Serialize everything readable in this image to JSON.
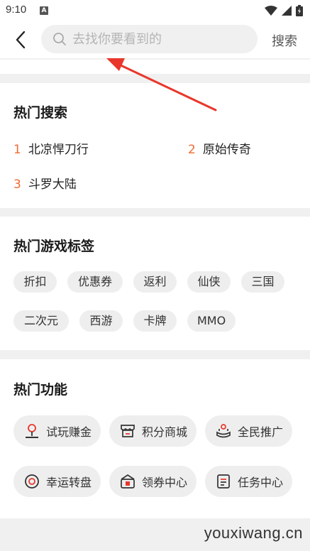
{
  "status": {
    "time": "9:10",
    "notif_letter": "A"
  },
  "header": {
    "search_placeholder": "去找你要看到的",
    "search_button": "搜索"
  },
  "hot_search": {
    "title": "热门搜索",
    "items": [
      {
        "num": "1",
        "label": "北凉悍刀行"
      },
      {
        "num": "2",
        "label": "原始传奇"
      },
      {
        "num": "3",
        "label": "斗罗大陆"
      }
    ]
  },
  "hot_tags": {
    "title": "热门游戏标签",
    "tags": [
      "折扣",
      "优惠券",
      "返利",
      "仙侠",
      "三国",
      "二次元",
      "西游",
      "卡牌",
      "MMO"
    ]
  },
  "hot_functions": {
    "title": "热门功能",
    "items": [
      {
        "label": "试玩赚金",
        "icon": "joystick-icon"
      },
      {
        "label": "积分商城",
        "icon": "store-icon"
      },
      {
        "label": "全民推广",
        "icon": "promote-icon"
      },
      {
        "label": "幸运转盘",
        "icon": "wheel-icon"
      },
      {
        "label": "领券中心",
        "icon": "coupon-icon"
      },
      {
        "label": "任务中心",
        "icon": "task-list-icon"
      }
    ]
  },
  "watermark": "youxiwang.cn",
  "colors": {
    "accent": "#ef6a35",
    "annotation_arrow": "#e8372c"
  }
}
